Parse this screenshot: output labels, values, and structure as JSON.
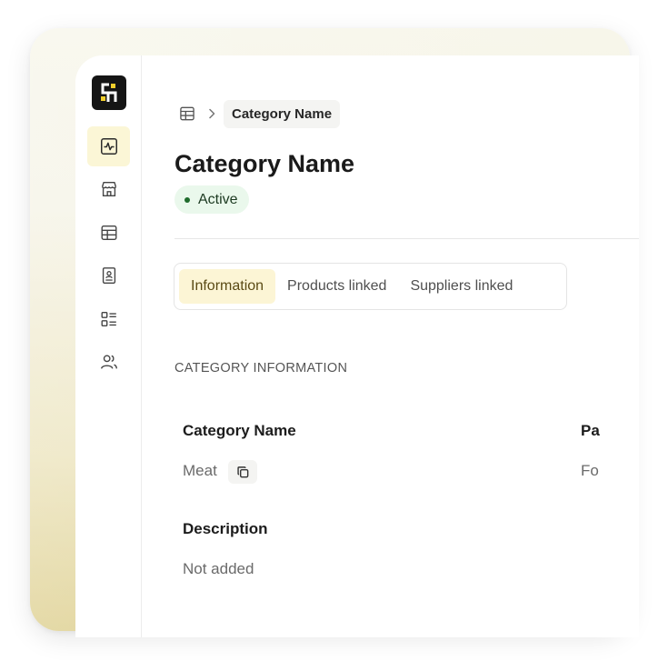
{
  "app": {
    "logo_text": "ch",
    "accent": "#f2cf2c"
  },
  "sidebar": {
    "items": [
      {
        "name": "activity",
        "icon": "activity-icon",
        "active": true
      },
      {
        "name": "store",
        "icon": "store-icon",
        "active": false
      },
      {
        "name": "table",
        "icon": "table-icon",
        "active": false
      },
      {
        "name": "contacts",
        "icon": "contact-book-icon",
        "active": false
      },
      {
        "name": "checklist",
        "icon": "checklist-icon",
        "active": false
      },
      {
        "name": "users",
        "icon": "users-icon",
        "active": false
      }
    ]
  },
  "breadcrumb": {
    "root_icon": "table-icon",
    "current": "Category Name"
  },
  "header": {
    "title": "Category Name",
    "status": "Active",
    "status_color": "#1f6b2c"
  },
  "tabs": [
    {
      "label": "Information",
      "active": true
    },
    {
      "label": "Products linked",
      "active": false
    },
    {
      "label": "Suppliers linked",
      "active": false
    }
  ],
  "section": {
    "title": "CATEGORY INFORMATION",
    "fields": {
      "category_name": {
        "label": "Category Name",
        "value": "Meat"
      },
      "parent": {
        "label": "Pa",
        "value": "Fo"
      },
      "description": {
        "label": "Description",
        "value": "Not added"
      }
    }
  }
}
